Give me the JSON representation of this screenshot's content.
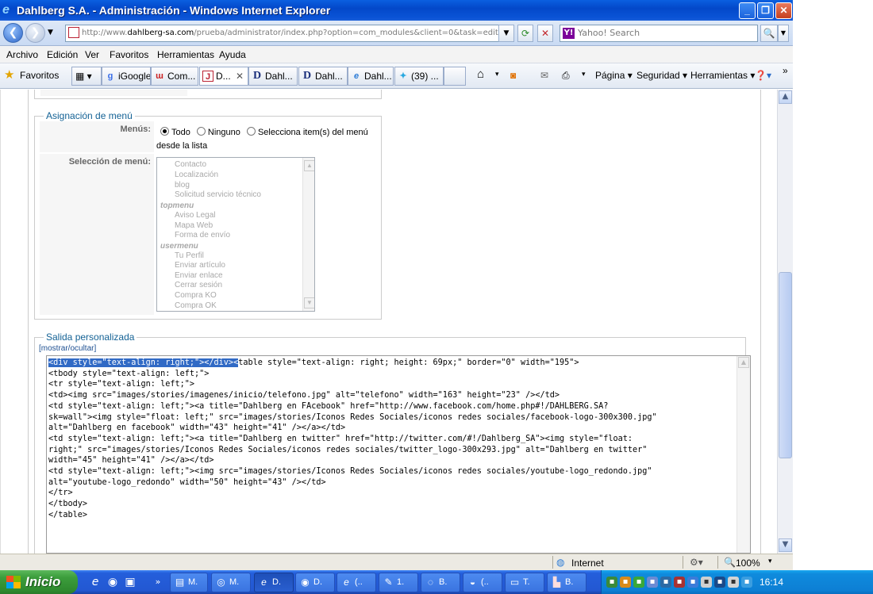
{
  "window": {
    "title": "Dahlberg S.A. - Administración - Windows Internet Explorer",
    "controls": [
      "_",
      "❐",
      "✕"
    ]
  },
  "address": {
    "url_prefix": "http://www.",
    "url_domain": "dahlberg-sa.com",
    "url_rest": "/prueba/administrator/index.php?option=com_modules&client=0&task=edit&id=11",
    "search_placeholder": "Yahoo! Search"
  },
  "menubar": [
    "Archivo",
    "Edición",
    "Ver",
    "Favoritos",
    "Herramientas",
    "Ayuda"
  ],
  "favbar": {
    "favorites_label": "Favoritos",
    "tabs": [
      {
        "label": "iGoogle",
        "icon": "google-icon"
      },
      {
        "label": "Com...",
        "icon": "w-icon"
      },
      {
        "label": "D...",
        "icon": "joomla-icon",
        "close": "✕"
      },
      {
        "label": "Dahl...",
        "icon": "d-icon"
      },
      {
        "label": "Dahl...",
        "icon": "d-icon"
      },
      {
        "label": "Dahl...",
        "icon": "ie-icon"
      },
      {
        "label": "(39) ...",
        "icon": "twitter-icon"
      }
    ],
    "commands": [
      "Página ▾",
      "Seguridad ▾",
      "Herramientas ▾"
    ]
  },
  "menu_assignment": {
    "legend": "Asignación de menú",
    "menus_label": "Menús:",
    "option_all": "Todo",
    "option_none": "Ninguno",
    "option_select": "Selecciona item(s) del menú",
    "option_select_cont": "desde la lista",
    "selection_label": "Selección de menú:",
    "list": [
      {
        "type": "opt",
        "text": "Contacto"
      },
      {
        "type": "opt",
        "text": "Localización"
      },
      {
        "type": "opt",
        "text": "blog"
      },
      {
        "type": "opt",
        "text": "Solicitud servicio técnico"
      },
      {
        "type": "grp",
        "text": "topmenu"
      },
      {
        "type": "opt",
        "text": "Aviso Legal"
      },
      {
        "type": "opt",
        "text": "Mapa Web"
      },
      {
        "type": "opt",
        "text": "Forma de envío"
      },
      {
        "type": "grp",
        "text": "usermenu"
      },
      {
        "type": "opt",
        "text": "Tu Perfil"
      },
      {
        "type": "opt",
        "text": "Enviar artículo"
      },
      {
        "type": "opt",
        "text": "Enviar enlace"
      },
      {
        "type": "opt",
        "text": "Cerrar sesión"
      },
      {
        "type": "opt",
        "text": "Compra KO"
      },
      {
        "type": "opt",
        "text": "Compra OK"
      }
    ]
  },
  "custom_output": {
    "legend": "Salida personalizada",
    "toggle": "[mostrar/ocultar]",
    "selected_code": "<div style=\"text-align: right;\"></div><",
    "code_rest": "table style=\"text-align: right; height: 69px;\" border=\"0\" width=\"195\">",
    "code_lines": [
      "<tbody style=\"text-align: left;\">",
      "<tr style=\"text-align: left;\">",
      "<td><img src=\"images/stories/imagenes/inicio/telefono.jpg\" alt=\"telefono\" width=\"163\" height=\"23\" /></td>",
      "<td style=\"text-align: left;\"><a title=\"Dahlberg en FAcebook\" href=\"http://www.facebook.com/home.php#!/DAHLBERG.SA?",
      "sk=wall\"><img style=\"float: left;\" src=\"images/stories/Iconos Redes Sociales/iconos redes sociales/facebook-logo-300x300.jpg\"",
      "alt=\"Dahlberg en facebook\" width=\"43\" height=\"41\" /></a></td>",
      "<td style=\"text-align: left;\"><a title=\"Dahlberg en twitter\" href=\"http://twitter.com/#!/Dahlberg_SA\"><img style=\"float:",
      "right;\" src=\"images/stories/Iconos Redes Sociales/iconos redes sociales/twitter_logo-300x293.jpg\" alt=\"Dahlberg en twitter\"",
      "width=\"45\" height=\"41\" /></a></td>",
      "<td style=\"text-align: left;\"><img src=\"images/stories/Iconos Redes Sociales/iconos redes sociales/youtube-logo_redondo.jpg\"",
      "alt=\"youtube-logo_redondo\" width=\"50\" height=\"43\" /></td>",
      "</tr>",
      "</tbody>",
      "</table>"
    ]
  },
  "status": {
    "zone": "Internet",
    "zoom": "100%"
  },
  "taskbar": {
    "start": "Inicio",
    "tasks": [
      "M.",
      "M.",
      "D.",
      "D.",
      "(..",
      "1.",
      "B.",
      "(..",
      "T.",
      "B."
    ],
    "clock": "16:14"
  }
}
